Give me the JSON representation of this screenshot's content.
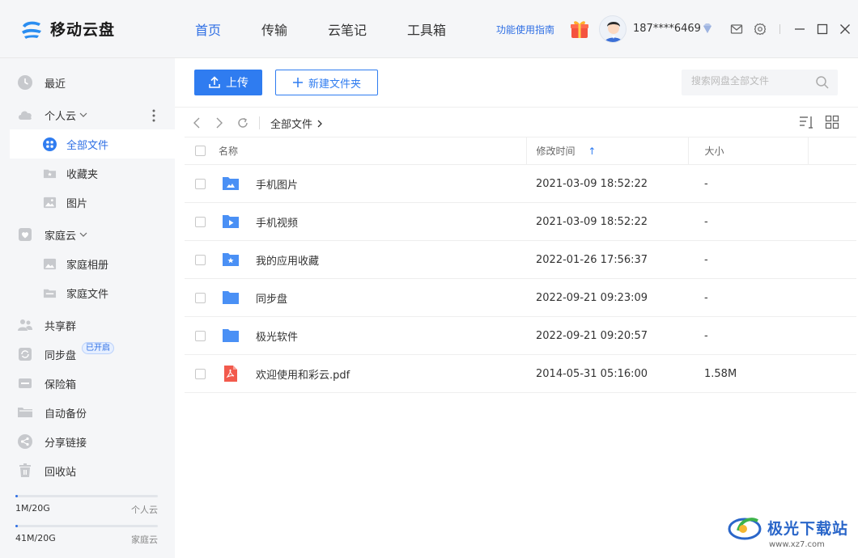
{
  "app": {
    "name": "移动云盘"
  },
  "nav": {
    "tabs": [
      "首页",
      "传输",
      "云笔记",
      "工具箱"
    ],
    "active": 0
  },
  "header": {
    "guide_label": "功能使用指南",
    "phone": "187****6469"
  },
  "sidebar": {
    "recent": "最近",
    "personal_cloud": "个人云",
    "all_files": "全部文件",
    "favorites": "收藏夹",
    "pictures": "图片",
    "family_cloud": "家庭云",
    "family_album": "家庭相册",
    "family_files": "家庭文件",
    "share_group": "共享群",
    "sync_disk": "同步盘",
    "sync_badge": "已开启",
    "safe_box": "保险箱",
    "auto_backup": "自动备份",
    "share_link": "分享链接",
    "recycle_bin": "回收站"
  },
  "quota": [
    {
      "used": "1M/20G",
      "label": "个人云",
      "fraction": 0.01
    },
    {
      "used": "41M/20G",
      "label": "家庭云",
      "fraction": 0.01
    }
  ],
  "toolbar": {
    "upload": "上传",
    "new_folder": "新建文件夹",
    "search_placeholder": "搜索网盘全部文件",
    "breadcrumb": "全部文件"
  },
  "table": {
    "headers": {
      "name": "名称",
      "modified": "修改时间",
      "size": "大小"
    },
    "sort_indicator": "↑",
    "rows": [
      {
        "name": "手机图片",
        "modified": "2021-03-09 18:52:22",
        "size": "-",
        "icon": "folder-image-icon"
      },
      {
        "name": "手机视频",
        "modified": "2021-03-09 18:52:22",
        "size": "-",
        "icon": "folder-video-icon"
      },
      {
        "name": "我的应用收藏",
        "modified": "2022-01-26 17:56:37",
        "size": "-",
        "icon": "folder-star-icon"
      },
      {
        "name": "同步盘",
        "modified": "2022-09-21 09:23:09",
        "size": "-",
        "icon": "folder-icon"
      },
      {
        "name": "极光软件",
        "modified": "2022-09-21 09:20:57",
        "size": "-",
        "icon": "folder-icon"
      },
      {
        "name": "欢迎使用和彩云.pdf",
        "modified": "2014-05-31 05:16:00",
        "size": "1.58M",
        "icon": "pdf-icon"
      }
    ]
  },
  "watermark": {
    "text": "极光下载站",
    "url": "www.xz7.com"
  },
  "colors": {
    "accent": "#2f7cf0",
    "folder": "#4a90f5",
    "pdf": "#f25a4d"
  }
}
